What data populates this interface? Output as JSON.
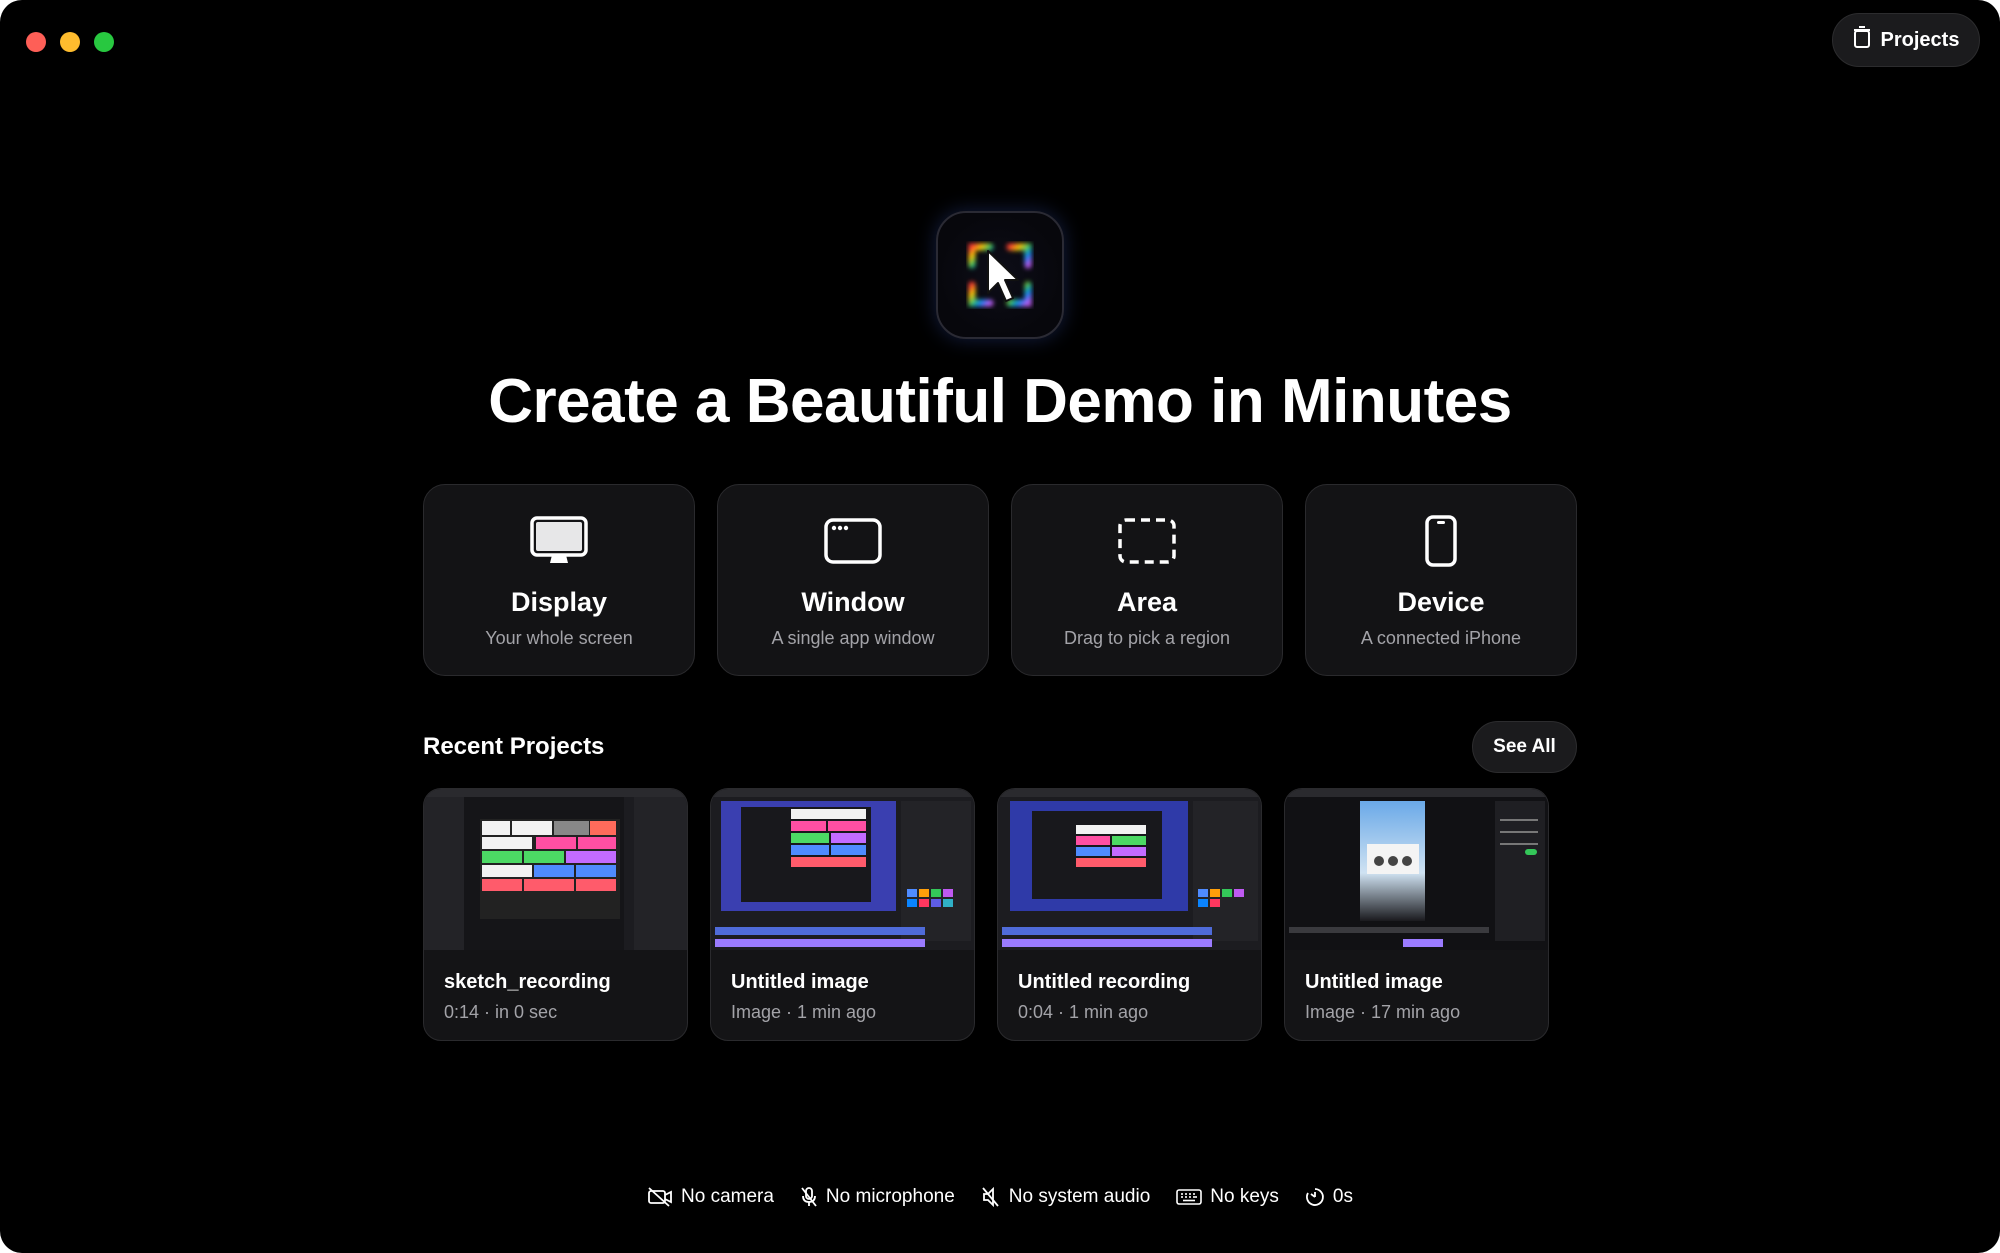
{
  "window": {
    "projects_button_label": "Projects"
  },
  "hero": {
    "headline": "Create a Beautiful Demo in Minutes"
  },
  "modes": [
    {
      "title": "Display",
      "subtitle": "Your whole screen",
      "icon": "monitor-icon"
    },
    {
      "title": "Window",
      "subtitle": "A single app window",
      "icon": "app-window-icon"
    },
    {
      "title": "Area",
      "subtitle": "Drag to pick a region",
      "icon": "dashed-region-icon"
    },
    {
      "title": "Device",
      "subtitle": "A connected iPhone",
      "icon": "iphone-icon"
    }
  ],
  "recent": {
    "title": "Recent Projects",
    "see_all_label": "See All",
    "items": [
      {
        "name": "sketch_recording",
        "meta": "0:14 · in 0 sec"
      },
      {
        "name": "Untitled image",
        "meta": "Image · 1 min ago"
      },
      {
        "name": "Untitled recording",
        "meta": "0:04 · 1 min ago"
      },
      {
        "name": "Untitled image",
        "meta": "Image · 17 min ago"
      }
    ]
  },
  "status": [
    {
      "label": "No camera",
      "icon": "camera-off-icon"
    },
    {
      "label": "No microphone",
      "icon": "microphone-off-icon"
    },
    {
      "label": "No system audio",
      "icon": "speaker-off-icon"
    },
    {
      "label": "No keys",
      "icon": "keyboard-icon"
    },
    {
      "label": "0s",
      "icon": "timer-icon"
    }
  ],
  "colors": {
    "background": "#000000",
    "card": "#131315",
    "secondary_text": "#a3a3a8",
    "close": "#fe5f57",
    "minimize": "#febc2e",
    "maximize": "#28c840"
  }
}
